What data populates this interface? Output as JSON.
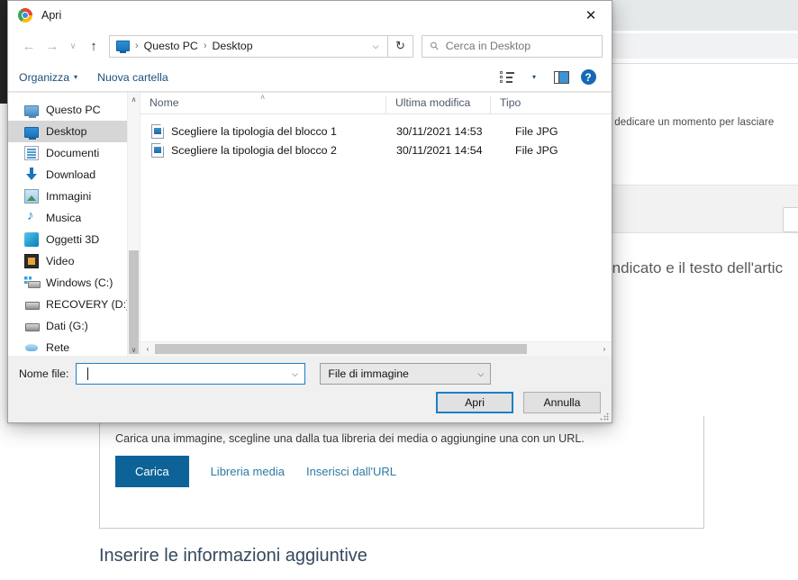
{
  "background": {
    "paragraph_fragment": "grati se potessi dedicare un momento per lasciare",
    "big_text_fragment": "azio indicato e il testo dell'artic",
    "upload": {
      "help_text": "Carica una immagine, scegline una dalla tua libreria dei media o aggiungine una con un URL.",
      "primary_button": "Carica",
      "links": [
        "Libreria media",
        "Inserisci dall'URL"
      ],
      "accent_color": "#0d6398",
      "link_color": "#2c7ba3"
    },
    "section_heading": "Inserire le informazioni aggiuntive",
    "heading_color": "#34495e"
  },
  "dialog": {
    "title": "Apri",
    "title_icon": "chrome-icon",
    "close_label": "✕",
    "nav": {
      "back": "←",
      "forward": "→",
      "recent": "∨",
      "up": "↑",
      "breadcrumb": [
        "Questo PC",
        "Desktop"
      ],
      "breadcrumb_separator": "›",
      "dropdown_caret": "⌵",
      "refresh": "↻"
    },
    "search": {
      "placeholder": "Cerca in Desktop",
      "icon": "search-icon"
    },
    "commandbar": {
      "organize": "Organizza",
      "organize_caret": "▾",
      "new_folder": "Nuova cartella",
      "view_caret": "▾",
      "help_glyph": "?"
    },
    "sidebar": {
      "items": [
        {
          "label": "Questo PC",
          "icon": "computer-icon",
          "icon_class": "ico-pc",
          "selected": false
        },
        {
          "label": "Desktop",
          "icon": "desktop-icon",
          "icon_class": "ico-desktop",
          "selected": true
        },
        {
          "label": "Documenti",
          "icon": "documents-icon",
          "icon_class": "ico-doc",
          "selected": false
        },
        {
          "label": "Download",
          "icon": "download-icon",
          "icon_class": "ico-dl",
          "selected": false
        },
        {
          "label": "Immagini",
          "icon": "pictures-icon",
          "icon_class": "ico-img",
          "selected": false
        },
        {
          "label": "Musica",
          "icon": "music-icon",
          "icon_class": "ico-music",
          "selected": false
        },
        {
          "label": "Oggetti 3D",
          "icon": "3d-objects-icon",
          "icon_class": "ico-3d",
          "selected": false
        },
        {
          "label": "Video",
          "icon": "video-icon",
          "icon_class": "ico-video",
          "selected": false
        },
        {
          "label": "Windows (C:)",
          "icon": "windows-drive-icon",
          "icon_class": "ico-drive-c",
          "selected": false
        },
        {
          "label": "RECOVERY (D:)",
          "icon": "drive-icon",
          "icon_class": "ico-drive",
          "selected": false
        },
        {
          "label": "Dati (G:)",
          "icon": "drive-icon",
          "icon_class": "ico-drive",
          "selected": false
        },
        {
          "label": "Rete",
          "icon": "network-icon",
          "icon_class": "ico-net",
          "selected": false
        }
      ],
      "scroll_up": "∧",
      "scroll_down": "∨"
    },
    "filelist": {
      "columns": [
        "Nome",
        "Ultima modifica",
        "Tipo"
      ],
      "sort_marker": "˄",
      "rows": [
        {
          "name": "Scegliere la tipologia del blocco 1",
          "modified": "30/11/2021 14:53",
          "type": "File JPG",
          "icon": "jpg-file-icon"
        },
        {
          "name": "Scegliere la tipologia del blocco 2",
          "modified": "30/11/2021 14:54",
          "type": "File JPG",
          "icon": "jpg-file-icon"
        }
      ],
      "hscroll_left": "‹",
      "hscroll_right": "›"
    },
    "footer": {
      "filename_label": "Nome file:",
      "filename_value": "",
      "filename_caret": "⌵",
      "filter_value": "File di immagine",
      "filter_caret": "⌵",
      "open_button": "Apri",
      "cancel_button": "Annulla"
    }
  }
}
